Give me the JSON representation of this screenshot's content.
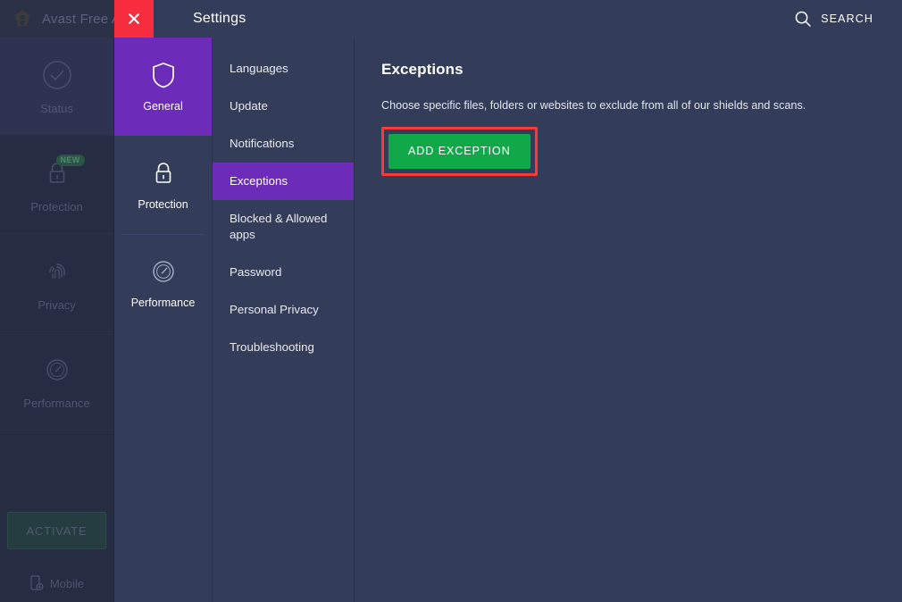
{
  "background_app": {
    "logo_icon": "avast-logo-icon",
    "title": "Avast Free A",
    "nav": [
      {
        "label": "Status",
        "icon": "check-circle-icon",
        "active": true,
        "badge": ""
      },
      {
        "label": "Protection",
        "icon": "lock-icon",
        "active": false,
        "badge": "NEW"
      },
      {
        "label": "Privacy",
        "icon": "fingerprint-icon",
        "active": false,
        "badge": ""
      },
      {
        "label": "Performance",
        "icon": "speedometer-icon",
        "active": false,
        "badge": ""
      }
    ],
    "activate_label": "ACTIVATE",
    "mobile_label": "Mobile",
    "mobile_icon": "mobile-add-icon"
  },
  "settings": {
    "title": "Settings",
    "close_icon": "close-icon",
    "search": {
      "label": "SEARCH",
      "icon": "search-icon"
    },
    "categories": [
      {
        "label": "General",
        "icon": "shield-icon",
        "active": true
      },
      {
        "label": "Protection",
        "icon": "lock-icon",
        "active": false
      },
      {
        "label": "Performance",
        "icon": "speedometer-icon",
        "active": false
      }
    ],
    "submenu": [
      {
        "label": "Languages",
        "active": false
      },
      {
        "label": "Update",
        "active": false
      },
      {
        "label": "Notifications",
        "active": false
      },
      {
        "label": "Exceptions",
        "active": true
      },
      {
        "label": "Blocked & Allowed apps",
        "active": false
      },
      {
        "label": "Password",
        "active": false
      },
      {
        "label": "Personal Privacy",
        "active": false
      },
      {
        "label": "Troubleshooting",
        "active": false
      }
    ],
    "panel": {
      "heading": "Exceptions",
      "description": "Choose specific files, folders or websites to exclude from all of our shields and scans.",
      "add_button_label": "ADD EXCEPTION"
    }
  },
  "colors": {
    "panel_bg": "#333d5a",
    "sidebar_bg": "#262c41",
    "accent_purple": "#6c2bb9",
    "close_red": "#f82d3f",
    "button_green": "#11a84a",
    "highlight_red": "#fc3a3a"
  }
}
